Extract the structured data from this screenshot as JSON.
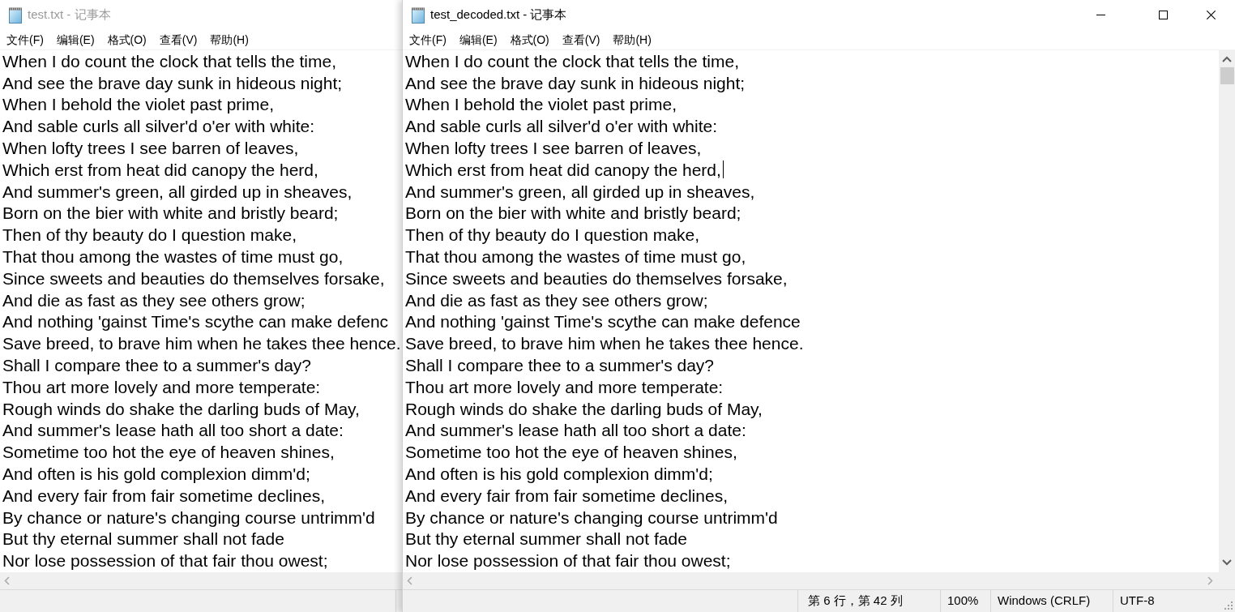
{
  "windows": [
    {
      "title": "test.txt - 记事本",
      "active": false,
      "menu": [
        "文件(F)",
        "编辑(E)",
        "格式(O)",
        "查看(V)",
        "帮助(H)"
      ],
      "lines": [
        {
          "text": "When I do count the clock that tells the time,",
          "caret": false
        },
        {
          "text": "And see the brave day sunk in hideous night;",
          "caret": false
        },
        {
          "text": "When I behold the violet past prime,",
          "caret": false
        },
        {
          "text": "And sable curls all silver'd o'er with white:",
          "caret": false
        },
        {
          "text": "When lofty trees I see barren of leaves,",
          "caret": false
        },
        {
          "text": "Which erst from heat did canopy the herd,",
          "caret": false
        },
        {
          "text": "And summer's green, all girded up in sheaves,",
          "caret": false
        },
        {
          "text": "Born on the bier with white and bristly beard;",
          "caret": false
        },
        {
          "text": "Then of thy beauty do I question make,",
          "caret": false
        },
        {
          "text": "That thou among the wastes of time must go,",
          "caret": false
        },
        {
          "text": "Since sweets and beauties do themselves forsake,",
          "caret": false
        },
        {
          "text": "And die as fast as they see others grow;",
          "caret": false
        },
        {
          "text": "And nothing 'gainst Time's scythe can make defenc",
          "caret": false
        },
        {
          "text": "Save breed, to brave him when he takes thee hence.",
          "caret": false
        },
        {
          "text": "Shall I compare thee to a summer's day?",
          "caret": false
        },
        {
          "text": "Thou art more lovely and more temperate:",
          "caret": false
        },
        {
          "text": "Rough winds do shake the darling buds of May,",
          "caret": false
        },
        {
          "text": "And summer's lease hath all too short a date:",
          "caret": false
        },
        {
          "text": "Sometime too hot the eye of heaven shines,",
          "caret": false
        },
        {
          "text": "And often is his gold complexion dimm'd;",
          "caret": false
        },
        {
          "text": "And every fair from fair sometime declines,",
          "caret": false
        },
        {
          "text": "By chance or nature's changing course untrimm'd",
          "caret": false
        },
        {
          "text": "But thy eternal summer shall not fade",
          "caret": false
        },
        {
          "text": "Nor lose possession of that fair thou owest;",
          "caret": false
        }
      ]
    },
    {
      "title": "test_decoded.txt - 记事本",
      "active": true,
      "menu": [
        "文件(F)",
        "编辑(E)",
        "格式(O)",
        "查看(V)",
        "帮助(H)"
      ],
      "lines": [
        {
          "text": "When I do count the clock that tells the time,",
          "caret": false
        },
        {
          "text": "And see the brave day sunk in hideous night;",
          "caret": false
        },
        {
          "text": "When I behold the violet past prime,",
          "caret": false
        },
        {
          "text": "And sable curls all silver'd o'er with white:",
          "caret": false
        },
        {
          "text": "When lofty trees I see barren of leaves,",
          "caret": false
        },
        {
          "text": "Which erst from heat did canopy the herd,",
          "caret": true
        },
        {
          "text": "And summer's green, all girded up in sheaves,",
          "caret": false
        },
        {
          "text": "Born on the bier with white and bristly beard;",
          "caret": false
        },
        {
          "text": "Then of thy beauty do I question make,",
          "caret": false
        },
        {
          "text": "That thou among the wastes of time must go,",
          "caret": false
        },
        {
          "text": "Since sweets and beauties do themselves forsake,",
          "caret": false
        },
        {
          "text": "And die as fast as they see others grow;",
          "caret": false
        },
        {
          "text": "And nothing 'gainst Time's scythe can make defence",
          "caret": false
        },
        {
          "text": "Save breed, to brave him when he takes thee hence.",
          "caret": false
        },
        {
          "text": "Shall I compare thee to a summer's day?",
          "caret": false
        },
        {
          "text": "Thou art more lovely and more temperate:",
          "caret": false
        },
        {
          "text": "Rough winds do shake the darling buds of May,",
          "caret": false
        },
        {
          "text": "And summer's lease hath all too short a date:",
          "caret": false
        },
        {
          "text": "Sometime too hot the eye of heaven shines,",
          "caret": false
        },
        {
          "text": "And often is his gold complexion dimm'd;",
          "caret": false
        },
        {
          "text": "And every fair from fair sometime declines,",
          "caret": false
        },
        {
          "text": "By chance or nature's changing course untrimm'd",
          "caret": false
        },
        {
          "text": "But thy eternal summer shall not fade",
          "caret": false
        },
        {
          "text": "Nor lose possession of that fair thou owest;",
          "caret": false
        }
      ],
      "status_bar": [
        "第 6 行，第 42 列",
        "100%",
        "Windows (CRLF)",
        "UTF-8"
      ]
    }
  ]
}
